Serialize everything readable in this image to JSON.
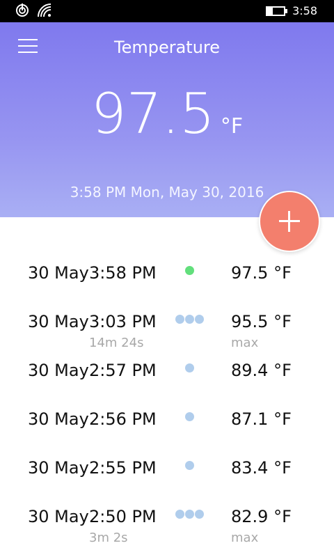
{
  "status_bar": {
    "time": "3:58",
    "battery_level": 0.35
  },
  "header": {
    "title": "Temperature",
    "reading": "97.5",
    "unit": "°F",
    "timestamp": "3:58 PM Mon, May 30, 2016"
  },
  "colors": {
    "accent": "#7f79ee",
    "fab": "#f37f6d",
    "dot_current": "#62df7c",
    "dot_past": "#b0cdec"
  },
  "readings": [
    {
      "date": "30 May",
      "time": "3:58 PM",
      "temp": "97.5 °F",
      "dots": 1,
      "current": true,
      "duration": "",
      "stat": ""
    },
    {
      "date": "30 May",
      "time": "3:03 PM",
      "temp": "95.5 °F",
      "dots": 3,
      "current": false,
      "duration": "14m 24s",
      "stat": "max"
    },
    {
      "date": "30 May",
      "time": "2:57 PM",
      "temp": "89.4 °F",
      "dots": 1,
      "current": false,
      "duration": "",
      "stat": ""
    },
    {
      "date": "30 May",
      "time": "2:56 PM",
      "temp": "87.1 °F",
      "dots": 1,
      "current": false,
      "duration": "",
      "stat": ""
    },
    {
      "date": "30 May",
      "time": "2:55 PM",
      "temp": "83.4 °F",
      "dots": 1,
      "current": false,
      "duration": "",
      "stat": ""
    },
    {
      "date": "30 May",
      "time": "2:50 PM",
      "temp": "82.9 °F",
      "dots": 3,
      "current": false,
      "duration": "3m 2s",
      "stat": "max"
    }
  ]
}
